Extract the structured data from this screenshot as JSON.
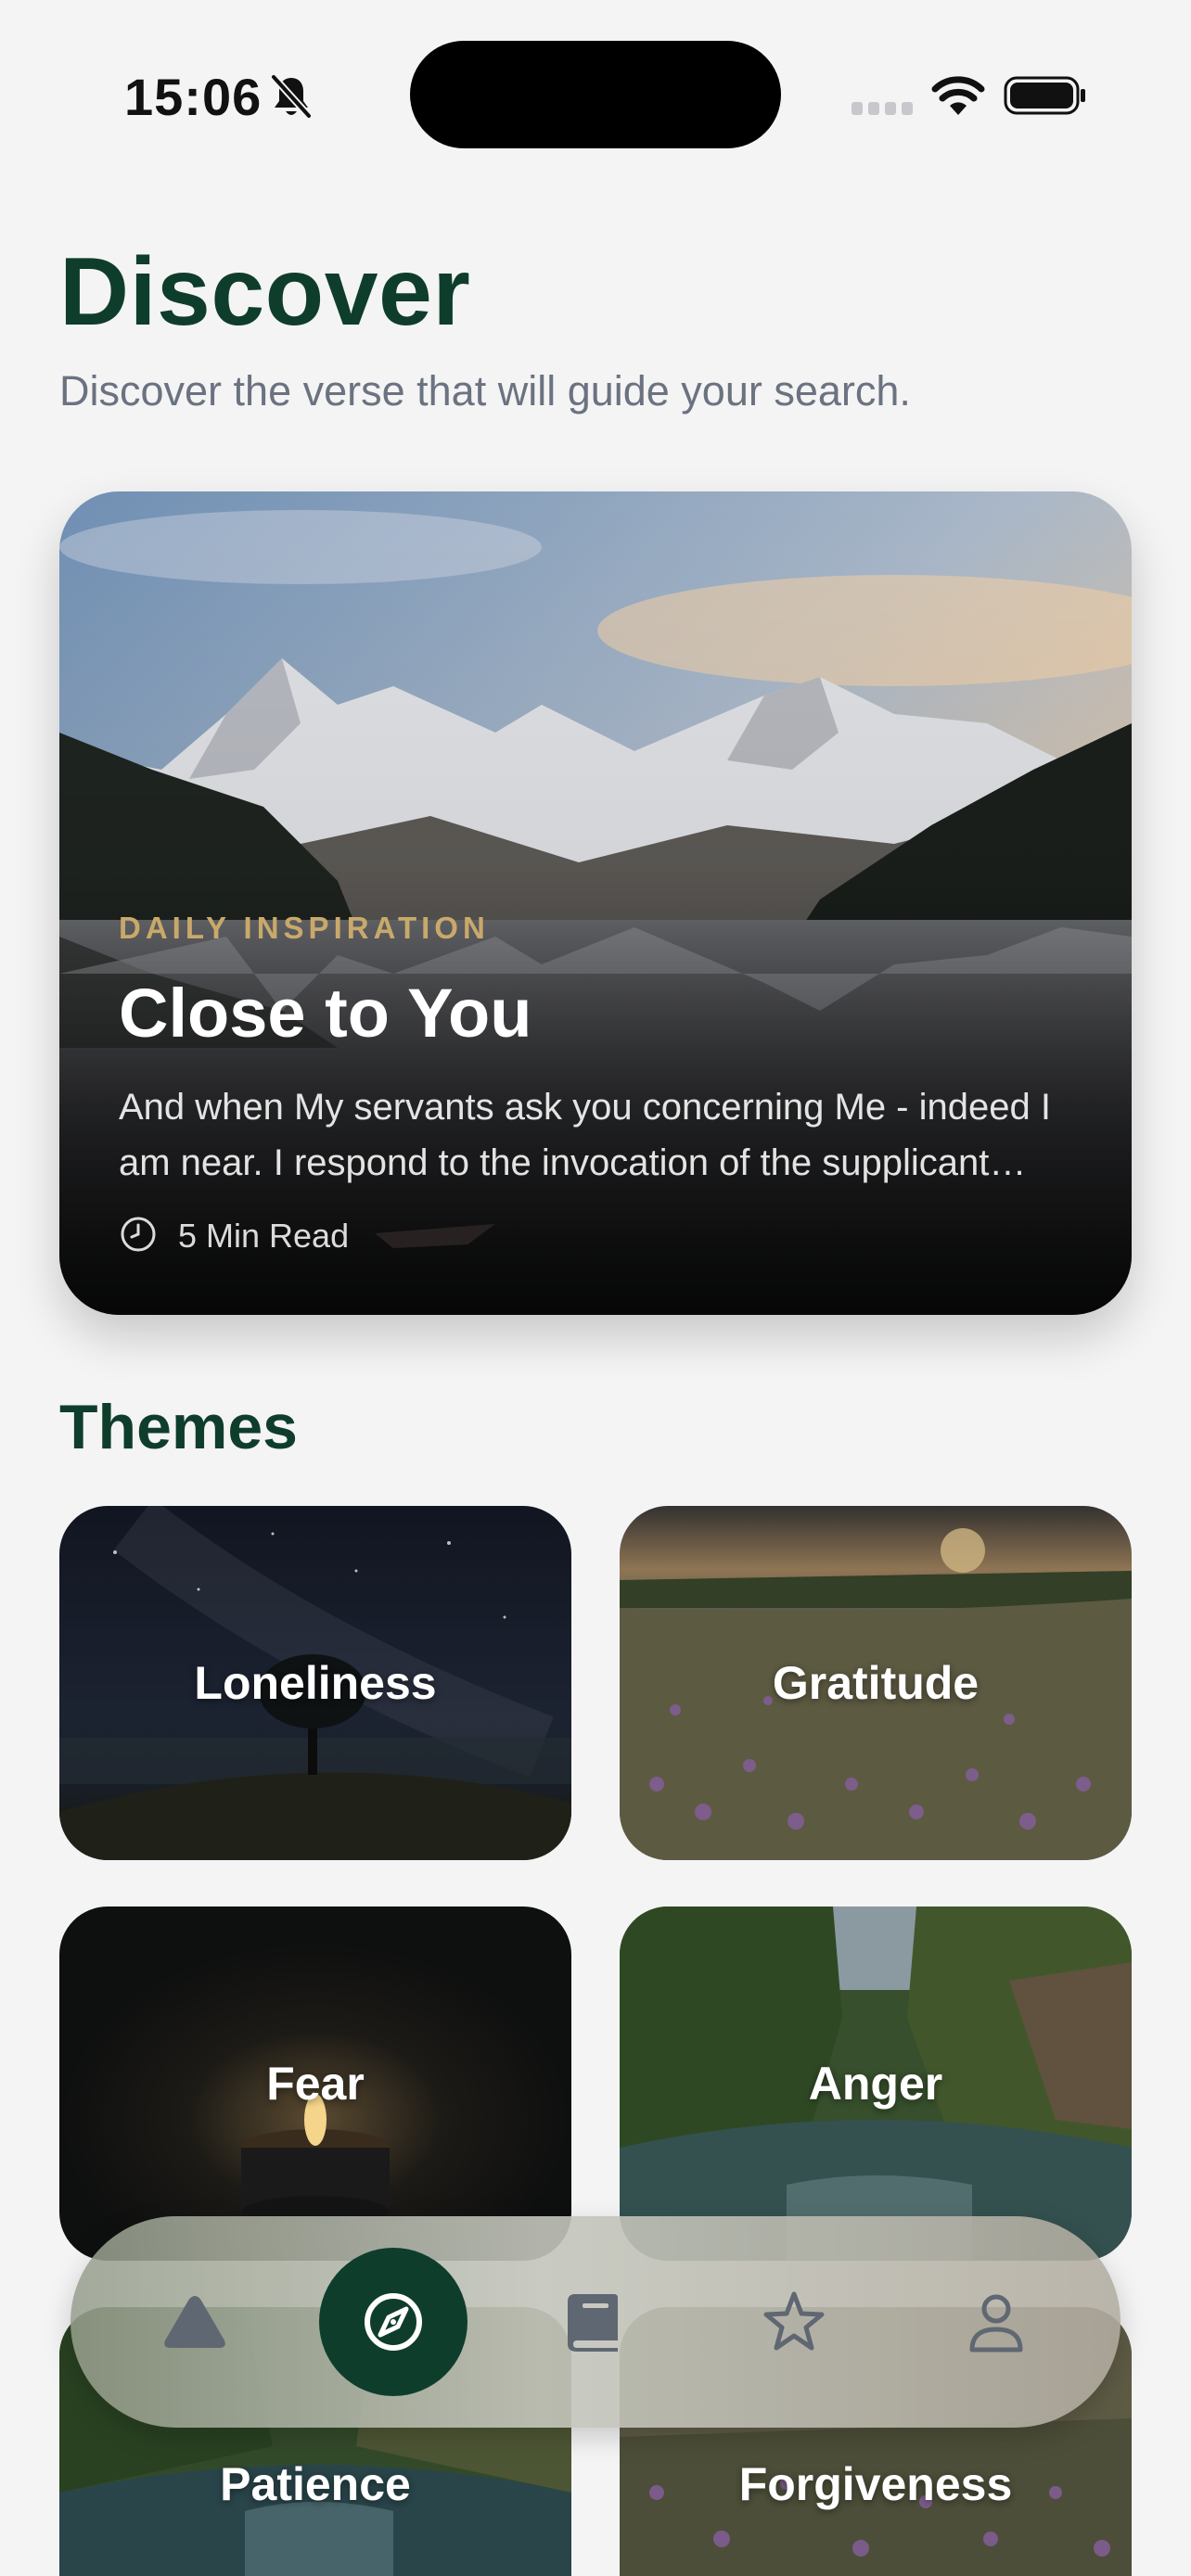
{
  "status_bar": {
    "time": "15:06"
  },
  "header": {
    "title": "Discover",
    "subtitle": "Discover the verse that will guide your search."
  },
  "featured": {
    "eyebrow": "DAILY INSPIRATION",
    "title": "Close to You",
    "excerpt": "And when My servants ask you concerning Me - indeed I am near. I respond to the invocation of the supplicant when he calls upon Me.",
    "read_time": "5 Min Read"
  },
  "themes": {
    "title": "Themes",
    "items": [
      {
        "label": "Loneliness"
      },
      {
        "label": "Gratitude"
      },
      {
        "label": "Fear"
      },
      {
        "label": "Anger"
      },
      {
        "label": "Patience"
      },
      {
        "label": "Forgiveness"
      }
    ]
  },
  "tab_bar": {
    "active": "discover",
    "tabs": [
      {
        "id": "home",
        "icon": "triangle-icon"
      },
      {
        "id": "discover",
        "icon": "compass-icon"
      },
      {
        "id": "library",
        "icon": "book-icon"
      },
      {
        "id": "favorites",
        "icon": "star-icon"
      },
      {
        "id": "profile",
        "icon": "person-icon"
      }
    ]
  },
  "colors": {
    "brand_green": "#0f3d2c",
    "accent_gold": "#c9a96a",
    "background": "#f4f4f5",
    "subtitle_gray": "#6b7280",
    "inactive_icon": "#5f6772"
  }
}
